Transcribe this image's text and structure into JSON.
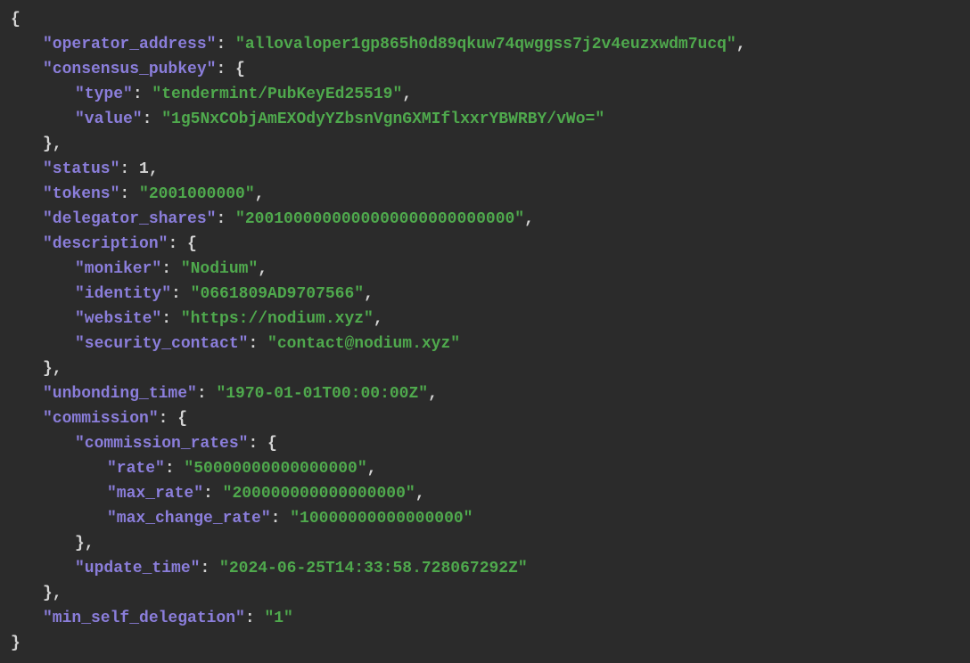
{
  "operator_address_key": "\"operator_address\"",
  "operator_address_val": "\"allovaloper1gp865h0d89qkuw74qwggss7j2v4euzxwdm7ucq\"",
  "consensus_pubkey_key": "\"consensus_pubkey\"",
  "type_key": "\"type\"",
  "type_val": "\"tendermint/PubKeyEd25519\"",
  "value_key": "\"value\"",
  "value_val": "\"1g5NxCObjAmEXOdyYZbsnVgnGXMIflxxrYBWRBY/vWo=\"",
  "status_key": "\"status\"",
  "status_val": "1",
  "tokens_key": "\"tokens\"",
  "tokens_val": "\"2001000000\"",
  "delegator_shares_key": "\"delegator_shares\"",
  "delegator_shares_val": "\"2001000000000000000000000000\"",
  "description_key": "\"description\"",
  "moniker_key": "\"moniker\"",
  "moniker_val": "\"Nodium\"",
  "identity_key": "\"identity\"",
  "identity_val": "\"0661809AD9707566\"",
  "website_key": "\"website\"",
  "website_val": "\"https://nodium.xyz\"",
  "security_contact_key": "\"security_contact\"",
  "security_contact_val": "\"contact@nodium.xyz\"",
  "unbonding_time_key": "\"unbonding_time\"",
  "unbonding_time_val": "\"1970-01-01T00:00:00Z\"",
  "commission_key": "\"commission\"",
  "commission_rates_key": "\"commission_rates\"",
  "rate_key": "\"rate\"",
  "rate_val": "\"50000000000000000\"",
  "max_rate_key": "\"max_rate\"",
  "max_rate_val": "\"200000000000000000\"",
  "max_change_rate_key": "\"max_change_rate\"",
  "max_change_rate_val": "\"10000000000000000\"",
  "update_time_key": "\"update_time\"",
  "update_time_val": "\"2024-06-25T14:33:58.728067292Z\"",
  "min_self_delegation_key": "\"min_self_delegation\"",
  "min_self_delegation_val": "\"1\"",
  "brace_open": "{",
  "brace_close": "}",
  "brace_close_comma": "},",
  "colon_space": ": ",
  "comma": ","
}
